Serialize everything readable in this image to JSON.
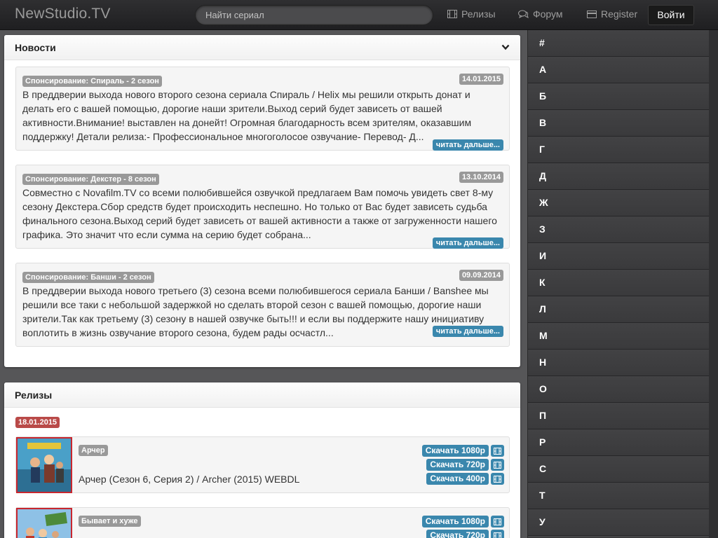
{
  "header": {
    "brand": "NewStudio.TV",
    "search_placeholder": "Найти сериал",
    "nav": {
      "releases": "Релизы",
      "forum": "Форум",
      "register": "Register",
      "login": "Войти"
    }
  },
  "news": {
    "title": "Новости",
    "read_more": "читать дальше...",
    "items": [
      {
        "title": "Спонсирование: Спираль - 2 сезон",
        "date": "14.01.2015",
        "text": "В преддверии выхода нового второго сезона сериала Спираль / Helix мы решили открыть донат и делать его с вашей помощью, дорогие наши зрители.Выход серий будет зависеть от вашей активности.Внимание! выставлен на донейт! Огромная благодарность всем зрителям, оказавшим поддержку! Детали релиза:- Профессиональное многоголосое озвучание- Перевод- Д..."
      },
      {
        "title": "Спонсирование: Декстер - 8 сезон",
        "date": "13.10.2014",
        "text": "Совместно с Novafilm.TV со всеми полюбившейся озвучкой предлагаем Вам помочь увидеть свет 8-му сезону Декстера.Сбор средств будет происходить неспешно. Но только от Вас будет зависеть судьба финального сезона.Выход серий будет зависеть от вашей активности а также от загруженности нашего графика. Это значит что если сумма на серию будет собрана..."
      },
      {
        "title": "Спонсирование: Банши - 2 сезон",
        "date": "09.09.2014",
        "text": "В преддверии выхода нового третьего (3) сезона всеми полюбившегося сериала Банши / Banshee мы решили все таки с небольшой задержкой но сделать второй сезон с вашей помощью, дорогие наши зрители.Так как третьему (3) сезону в нашей озвучке быть!!! и если вы поддержите нашу инициативу воплотить в жизнь озвучание второго сезона, будем рады осчастл..."
      }
    ]
  },
  "releases": {
    "title": "Релизы",
    "date": "18.01.2015",
    "items": [
      {
        "tag": "Арчер",
        "title": "Арчер (Сезон 6, Серия 2) / Archer (2015) WEBDL",
        "downloads": [
          "Скачать 1080p",
          "Скачать 720p",
          "Скачать 400p"
        ]
      },
      {
        "tag": "Бывает и хуже",
        "title": "",
        "downloads": [
          "Скачать 1080p",
          "Скачать 720p"
        ]
      }
    ]
  },
  "alphabet": [
    "#",
    "А",
    "Б",
    "В",
    "Г",
    "Д",
    "Ж",
    "З",
    "И",
    "К",
    "Л",
    "М",
    "Н",
    "О",
    "П",
    "Р",
    "С",
    "Т",
    "У"
  ],
  "colors": {
    "accent": "#3a87ad",
    "date_badge": "#b94a48",
    "label_gray": "#999999"
  }
}
